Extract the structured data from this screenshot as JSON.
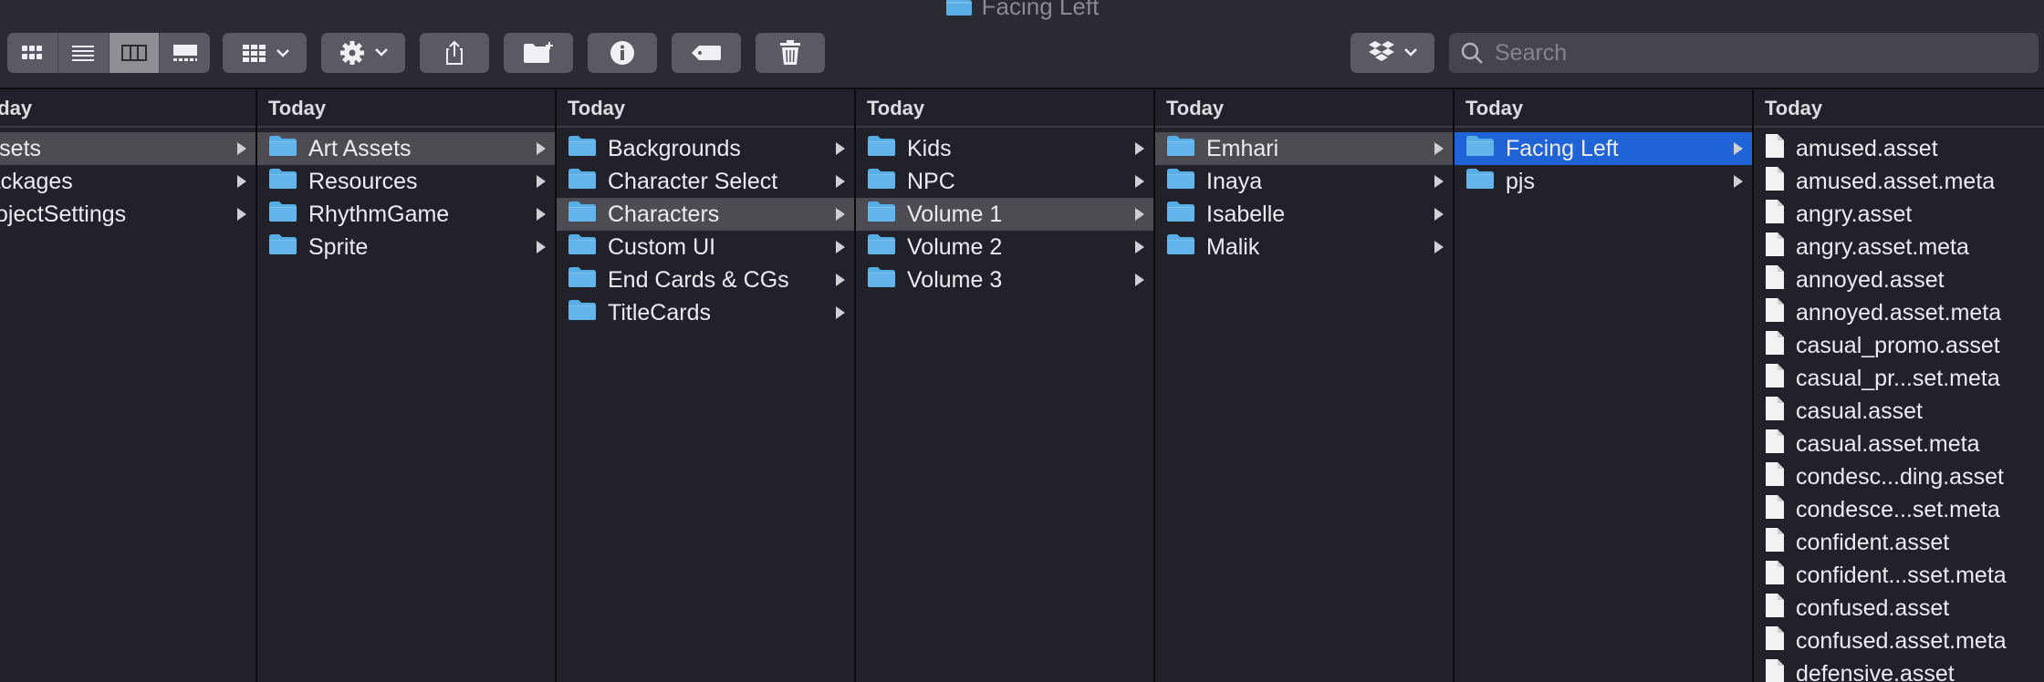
{
  "window": {
    "title": "Facing Left"
  },
  "toolbar": {
    "view_modes": [
      {
        "icon": "icon-view-icon"
      },
      {
        "icon": "list-view-icon"
      },
      {
        "icon": "column-view-icon",
        "active": true
      },
      {
        "icon": "gallery-view-icon"
      }
    ],
    "group_icon": "group-by-icon",
    "action_icon": "gear-icon",
    "share_icon": "share-icon",
    "new_folder_icon": "new-folder-icon",
    "info_icon": "info-icon",
    "tag_icon": "tag-icon",
    "trash_icon": "trash-icon",
    "dropbox_icon": "dropbox-icon"
  },
  "search": {
    "placeholder": "Search",
    "value": ""
  },
  "colors": {
    "folder_blue": "#5aaee6",
    "selection_blue": "#1f63d6",
    "selection_gray": "#4c4c52"
  },
  "columns": [
    {
      "header": "Today",
      "items": [
        {
          "label": "Assets",
          "kind": "text",
          "arrow": true,
          "selected": "gray"
        },
        {
          "label": "Packages",
          "kind": "text",
          "arrow": true
        },
        {
          "label": "ProjectSettings",
          "kind": "text",
          "arrow": true
        }
      ]
    },
    {
      "header": "Today",
      "items": [
        {
          "label": "Art Assets",
          "kind": "folder",
          "arrow": true,
          "selected": "gray"
        },
        {
          "label": "Resources",
          "kind": "folder",
          "arrow": true
        },
        {
          "label": "RhythmGame",
          "kind": "folder",
          "arrow": true
        },
        {
          "label": "Sprite",
          "kind": "folder",
          "arrow": true
        }
      ]
    },
    {
      "header": "Today",
      "items": [
        {
          "label": "Backgrounds",
          "kind": "folder",
          "arrow": true
        },
        {
          "label": "Character Select",
          "kind": "folder",
          "arrow": true
        },
        {
          "label": "Characters",
          "kind": "folder",
          "arrow": true,
          "selected": "gray"
        },
        {
          "label": "Custom UI",
          "kind": "folder",
          "arrow": true
        },
        {
          "label": "End Cards & CGs",
          "kind": "folder",
          "arrow": true
        },
        {
          "label": "TitleCards",
          "kind": "folder",
          "arrow": true
        }
      ]
    },
    {
      "header": "Today",
      "items": [
        {
          "label": "Kids",
          "kind": "folder",
          "arrow": true
        },
        {
          "label": "NPC",
          "kind": "folder",
          "arrow": true
        },
        {
          "label": "Volume 1",
          "kind": "folder",
          "arrow": true,
          "selected": "gray"
        },
        {
          "label": "Volume 2",
          "kind": "folder",
          "arrow": true
        },
        {
          "label": "Volume 3",
          "kind": "folder",
          "arrow": true
        }
      ]
    },
    {
      "header": "Today",
      "items": [
        {
          "label": "Emhari",
          "kind": "folder",
          "arrow": true,
          "selected": "gray"
        },
        {
          "label": "Inaya",
          "kind": "folder",
          "arrow": true
        },
        {
          "label": "Isabelle",
          "kind": "folder",
          "arrow": true
        },
        {
          "label": "Malik",
          "kind": "folder",
          "arrow": true
        }
      ]
    },
    {
      "header": "Today",
      "items": [
        {
          "label": "Facing Left",
          "kind": "folder",
          "arrow": true,
          "selected": "blue"
        },
        {
          "label": "pjs",
          "kind": "folder",
          "arrow": true
        }
      ]
    },
    {
      "header": "Today",
      "items": [
        {
          "label": "amused.asset",
          "kind": "file"
        },
        {
          "label": "amused.asset.meta",
          "kind": "file"
        },
        {
          "label": "angry.asset",
          "kind": "file"
        },
        {
          "label": "angry.asset.meta",
          "kind": "file"
        },
        {
          "label": "annoyed.asset",
          "kind": "file"
        },
        {
          "label": "annoyed.asset.meta",
          "kind": "file"
        },
        {
          "label": "casual_promo.asset",
          "kind": "file"
        },
        {
          "label": "casual_pr...set.meta",
          "kind": "file"
        },
        {
          "label": "casual.asset",
          "kind": "file"
        },
        {
          "label": "casual.asset.meta",
          "kind": "file"
        },
        {
          "label": "condesc...ding.asset",
          "kind": "file"
        },
        {
          "label": "condesce...set.meta",
          "kind": "file"
        },
        {
          "label": "confident.asset",
          "kind": "file"
        },
        {
          "label": "confident...sset.meta",
          "kind": "file"
        },
        {
          "label": "confused.asset",
          "kind": "file"
        },
        {
          "label": "confused.asset.meta",
          "kind": "file"
        },
        {
          "label": "defensive.asset",
          "kind": "file"
        }
      ]
    }
  ]
}
